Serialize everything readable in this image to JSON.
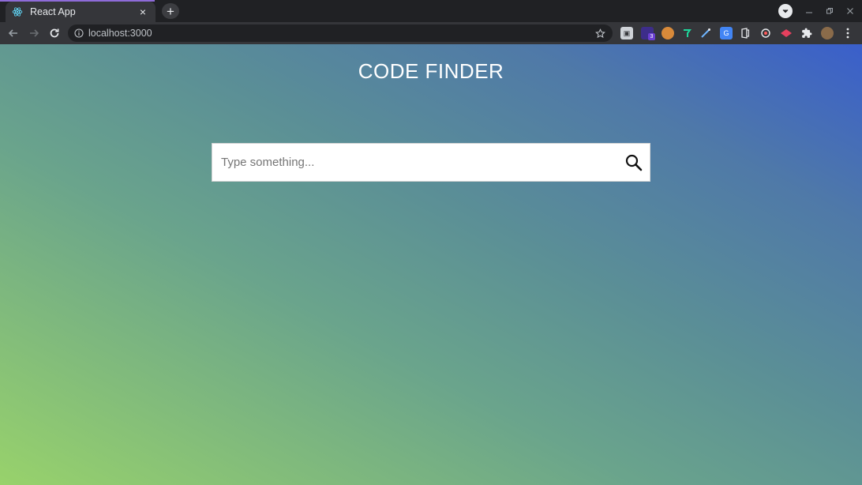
{
  "browser": {
    "tab": {
      "title": "React App",
      "favicon": "react-logo-icon",
      "close_label": "×"
    },
    "new_tab_label": "+",
    "omnibox": {
      "url": "localhost:3000",
      "info_icon": "info-icon",
      "bookmark_icon": "star-icon"
    },
    "extensions": [
      {
        "name": "extension-1-icon"
      },
      {
        "name": "extension-2-icon",
        "badge": "3"
      },
      {
        "name": "extension-3-icon"
      },
      {
        "name": "extension-4-icon"
      },
      {
        "name": "extension-5-icon"
      },
      {
        "name": "translate-icon"
      },
      {
        "name": "office-icon"
      },
      {
        "name": "extension-8-icon"
      },
      {
        "name": "extension-9-icon"
      },
      {
        "name": "puzzle-icon"
      },
      {
        "name": "avatar-icon"
      }
    ],
    "window_controls": [
      "minimize-icon",
      "restore-icon",
      "close-icon"
    ]
  },
  "page": {
    "title": "CODE FINDER",
    "search": {
      "placeholder": "Type something...",
      "value": "",
      "icon": "search-icon"
    }
  },
  "colors": {
    "gradient_start": "#98d26b",
    "gradient_end": "#3a5fcb",
    "title_text": "#ffffff",
    "search_bg": "#ffffff"
  }
}
